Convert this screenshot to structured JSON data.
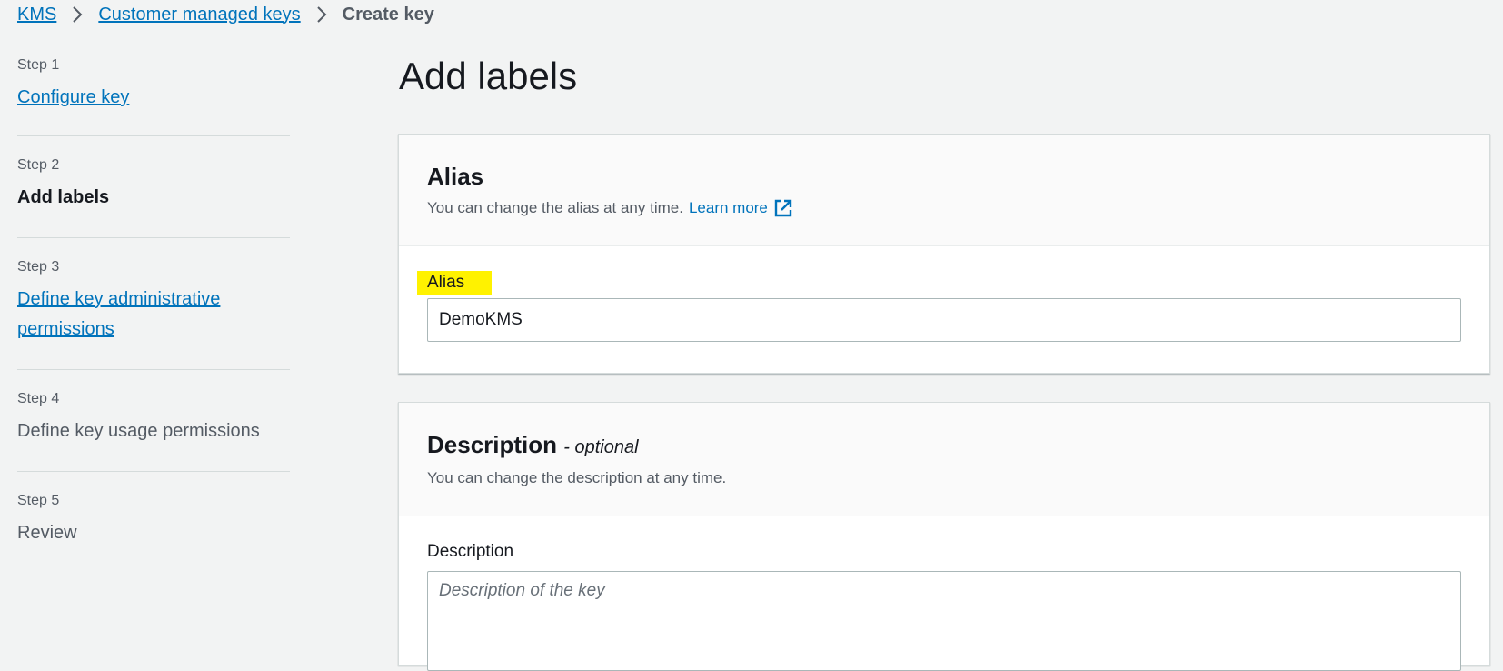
{
  "breadcrumb": {
    "items": [
      "KMS",
      "Customer managed keys"
    ],
    "current": "Create key"
  },
  "steps": [
    {
      "num": "Step 1",
      "title": "Configure key",
      "state": "link"
    },
    {
      "num": "Step 2",
      "title": "Add labels",
      "state": "active"
    },
    {
      "num": "Step 3",
      "title": "Define key administrative permissions",
      "state": "link"
    },
    {
      "num": "Step 4",
      "title": "Define key usage permissions",
      "state": "disabled"
    },
    {
      "num": "Step 5",
      "title": "Review",
      "state": "disabled"
    }
  ],
  "page": {
    "title": "Add labels"
  },
  "alias_panel": {
    "heading": "Alias",
    "description": "You can change the alias at any time.",
    "learn_more": "Learn more",
    "field_label": "Alias",
    "field_value": "DemoKMS"
  },
  "description_panel": {
    "heading": "Description",
    "optional": "- optional",
    "description": "You can change the description at any time.",
    "field_label": "Description",
    "placeholder": "Description of the key"
  },
  "colors": {
    "link": "#0073bb",
    "highlight": "#fff200",
    "background": "#f2f3f3"
  }
}
